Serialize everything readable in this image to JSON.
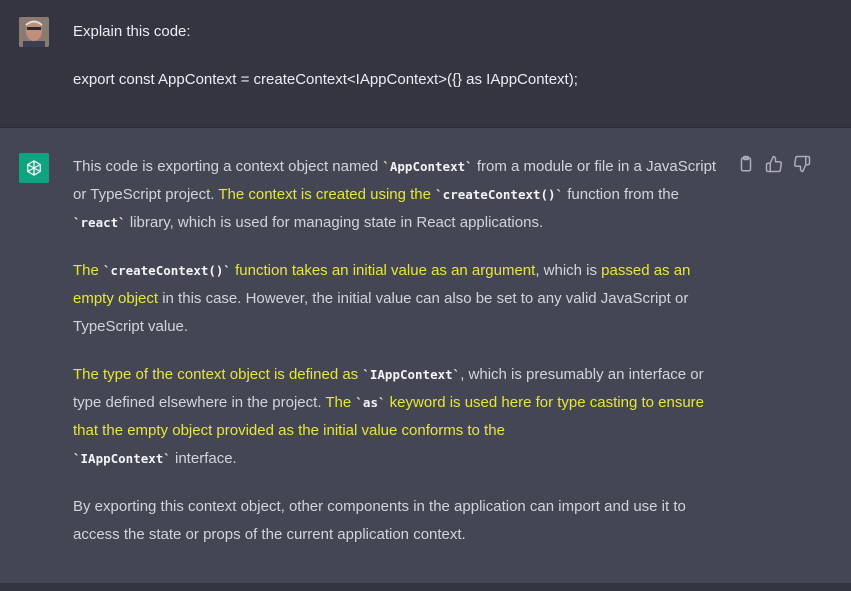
{
  "user_message": {
    "line1": "Explain this code:",
    "line2": "export const AppContext = createContext<IAppContext>({} as IAppContext);"
  },
  "assistant_message": {
    "p1": {
      "s1": "This code is exporting a context object named ",
      "c1": "`AppContext`",
      "s2": " from a module or file in a JavaScript or TypeScript project. ",
      "h1": "The context is created using the ",
      "c2": "`createContext()`",
      "s3": " function from the ",
      "c3": "`react`",
      "s4": " library, which is used for managing state in React applications."
    },
    "p2": {
      "h1": "The ",
      "c1": "`createContext()`",
      "h2": " function takes an initial value as an argument",
      "s1": ", which is ",
      "h3": "passed as an empty object",
      "s2": " in this case. However, the initial value can also be set to any valid JavaScript or TypeScript value."
    },
    "p3": {
      "h1": "The type of the context object is defined as ",
      "c1": "`IAppContext`",
      "s1": ", which is presumably an interface or type defined elsewhere in the project. ",
      "h2": "The ",
      "c2": "`as`",
      "h3": " keyword is used here for type casting to ensure that the empty object provided as the initial value conforms to the",
      "c3": "`IAppContext`",
      "s2": " interface."
    },
    "p4": "By exporting this context object, other components in the application can import and use it to access the state or props of the current application context."
  },
  "icons": [
    "user-avatar",
    "chatgpt-logo-icon",
    "clipboard-icon",
    "thumbs-up-icon",
    "thumbs-down-icon"
  ],
  "colors": {
    "user_bg": "#343541",
    "assistant_bg": "#444654",
    "brand_green": "#10a37f",
    "highlight_yellow": "#e6e63a"
  }
}
